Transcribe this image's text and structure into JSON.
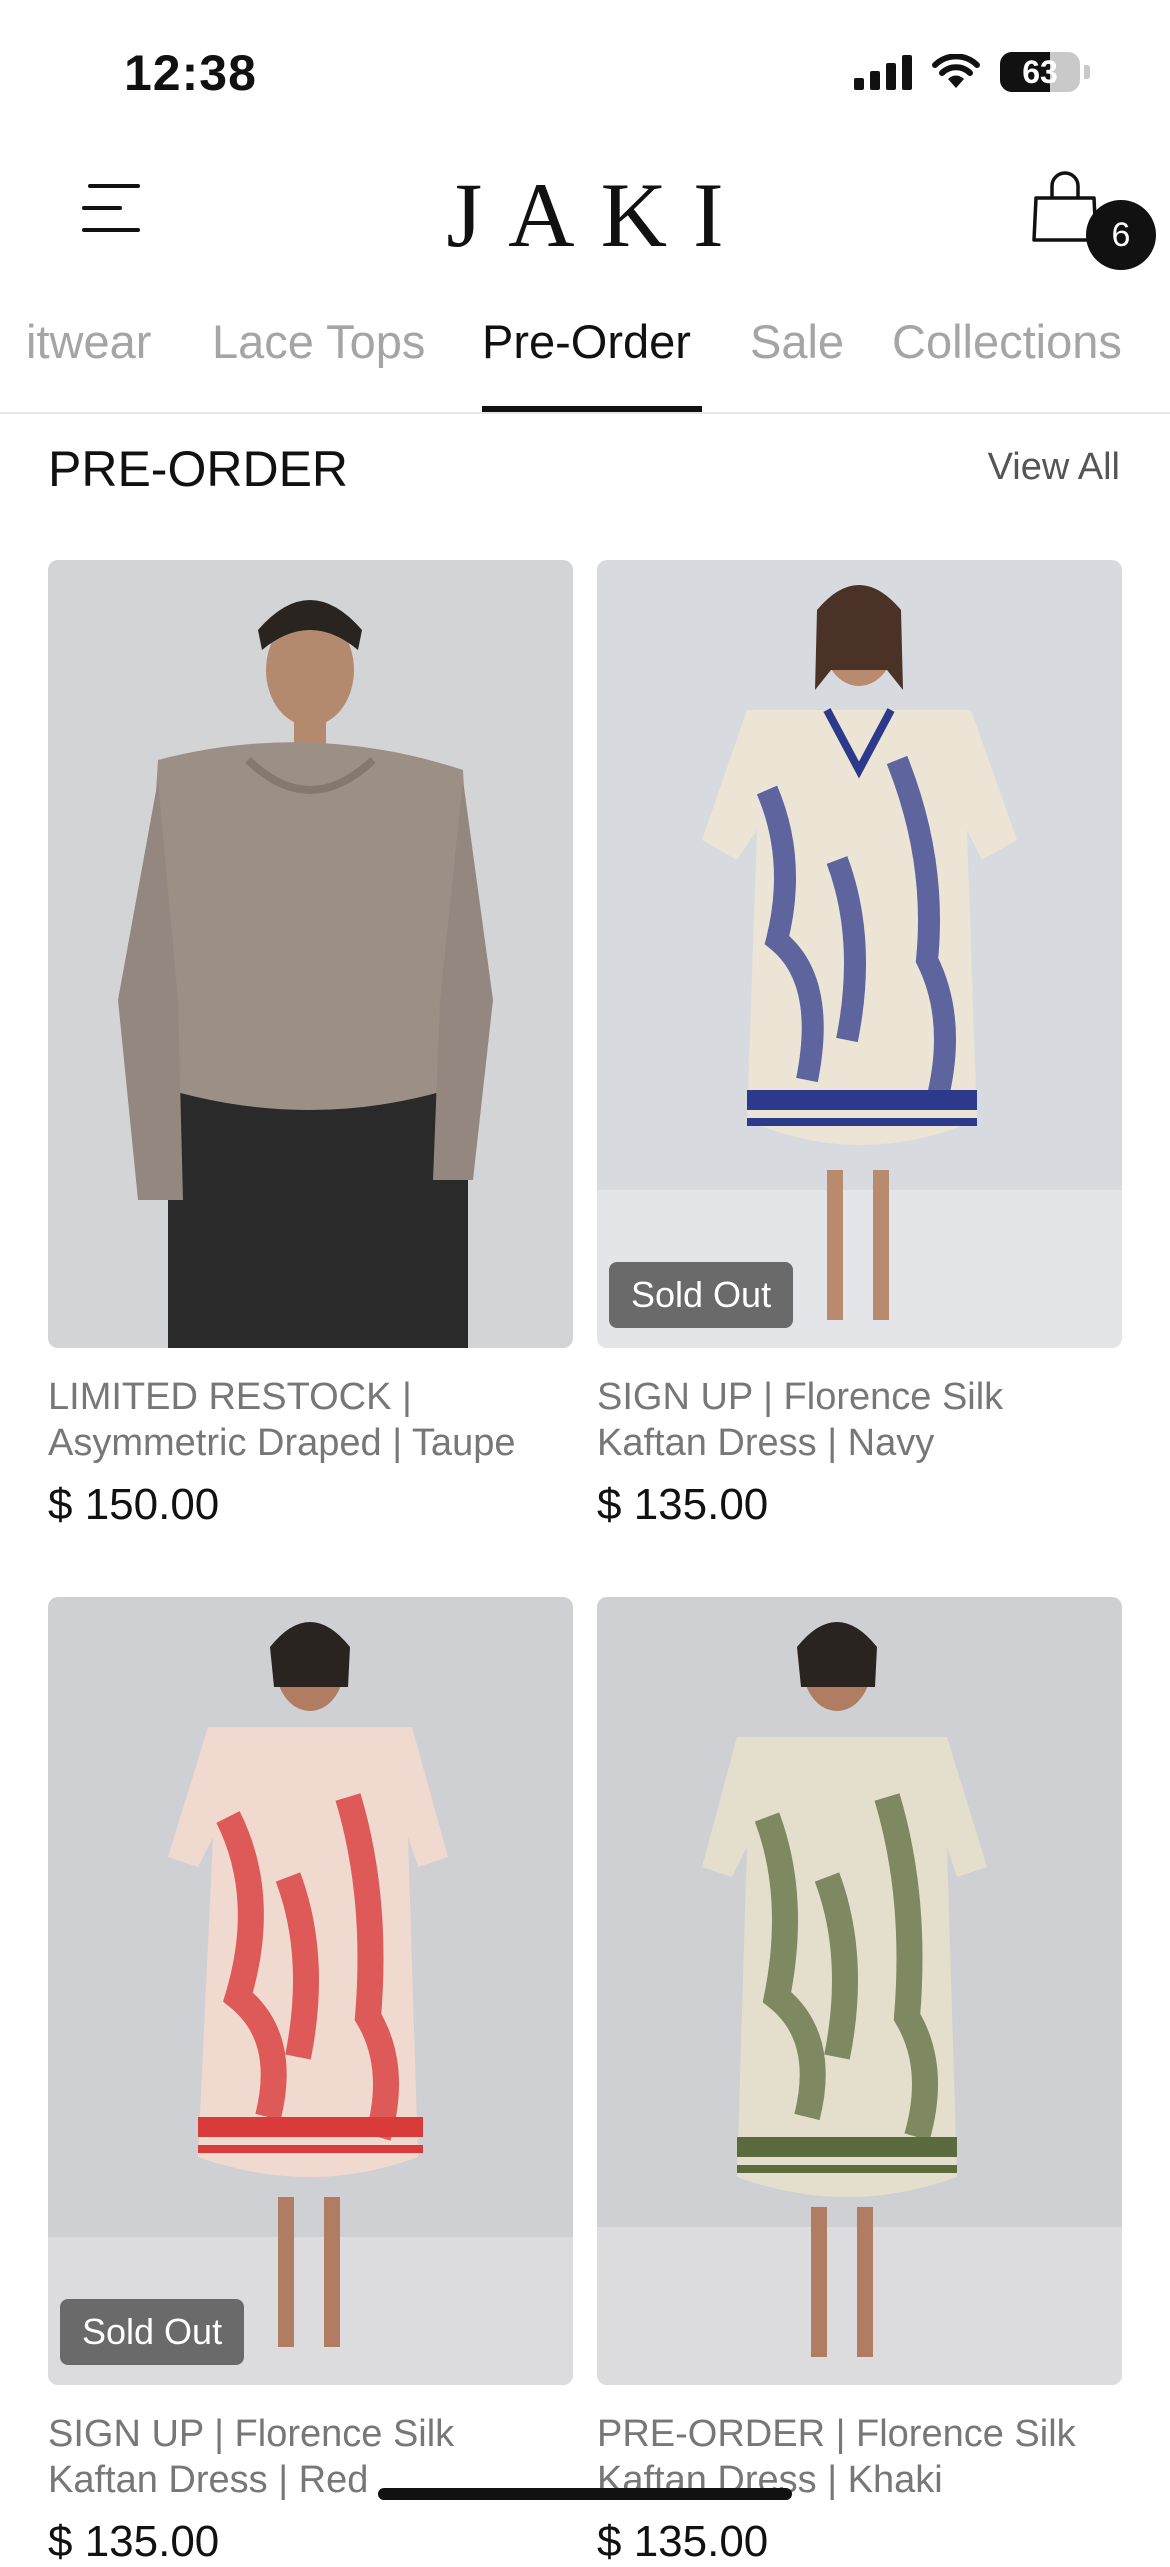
{
  "status_bar": {
    "time": "12:38",
    "battery": "63",
    "battery_level": 0.63,
    "icons": [
      "signal-icon",
      "wifi-icon",
      "battery-icon"
    ]
  },
  "header": {
    "logo": "JAKI",
    "cart_count": "6",
    "icons": [
      "menu-icon",
      "shopping-bag-icon"
    ]
  },
  "tabs": [
    {
      "label": "itwear",
      "active": false
    },
    {
      "label": "Lace Tops",
      "active": false
    },
    {
      "label": "Pre-Order",
      "active": true
    },
    {
      "label": "Sale",
      "active": false
    },
    {
      "label": "Collections",
      "active": false
    }
  ],
  "section": {
    "title": "PRE-ORDER",
    "view_all": "View All"
  },
  "products": [
    {
      "title_line1": "LIMITED RESTOCK |",
      "title_line2": "Asymmetric Draped | Taupe",
      "price": "$ 150.00",
      "badge": "",
      "colors": {
        "bg": "#d2d4d6",
        "garment": "#9c8f86",
        "accent": "#2a2a2a"
      }
    },
    {
      "title_line1": "SIGN UP | Florence Silk",
      "title_line2": "Kaftan Dress | Navy",
      "price": "$ 135.00",
      "badge": "Sold Out",
      "colors": {
        "bg": "#d7dbe0",
        "garment": "#ece4d4",
        "accent": "#2d3a8c"
      }
    },
    {
      "title_line1": "SIGN UP | Florence Silk",
      "title_line2": "Kaftan Dress | Red",
      "price": "$ 135.00",
      "badge": "Sold Out",
      "colors": {
        "bg": "#cfd0d4",
        "garment": "#f0d9cf",
        "accent": "#d93a3a"
      }
    },
    {
      "title_line1": "PRE-ORDER | Florence Silk",
      "title_line2": "Kaftan Dress | Khaki",
      "price": "$ 135.00",
      "badge": "",
      "colors": {
        "bg": "#cfd0d4",
        "garment": "#e4dfcc",
        "accent": "#5c6b3e"
      }
    }
  ]
}
